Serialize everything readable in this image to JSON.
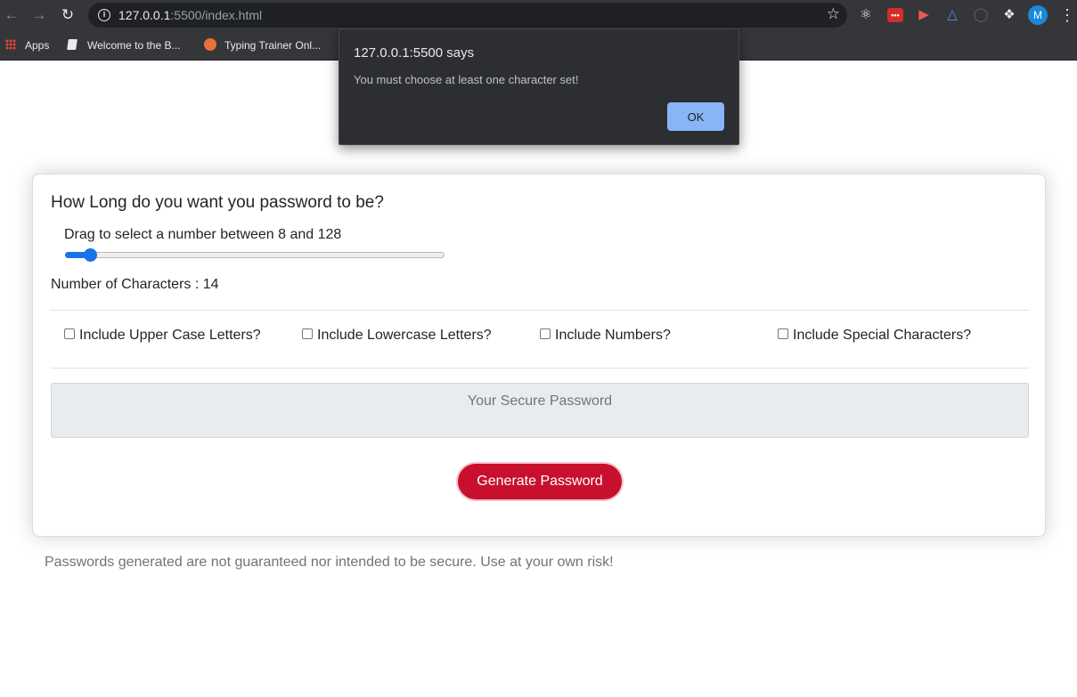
{
  "browser": {
    "url_host": "127.0.0.1",
    "url_rest": ":5500/index.html",
    "profile_initial": "M",
    "bookmarks": [
      {
        "label": "Apps"
      },
      {
        "label": "Welcome to the B..."
      },
      {
        "label": "Typing Trainer Onl..."
      }
    ]
  },
  "alert": {
    "title": "127.0.0.1:5500 says",
    "message": "You must choose at least one character set!",
    "ok_label": "OK"
  },
  "form": {
    "heading": "How Long do you want you password to be?",
    "slider_label": "Drag to select a number between 8 and 128",
    "slider": {
      "min": 8,
      "max": 128,
      "value": 14
    },
    "count_label": "Number of Characters : 14",
    "options": [
      {
        "label": "Include Upper Case Letters?",
        "checked": false
      },
      {
        "label": "Include Lowercase Letters?",
        "checked": false
      },
      {
        "label": "Include Numbers?",
        "checked": false
      },
      {
        "label": "Include Special Characters?",
        "checked": false
      }
    ],
    "password_placeholder": "Your Secure Password",
    "generate_label": "Generate Password"
  },
  "disclaimer": "Passwords generated are not guaranteed nor intended to be secure. Use at your own risk!",
  "colors": {
    "accent": "#1a73e8",
    "button": "#c8102e",
    "dialog_button": "#8ab4f8"
  }
}
